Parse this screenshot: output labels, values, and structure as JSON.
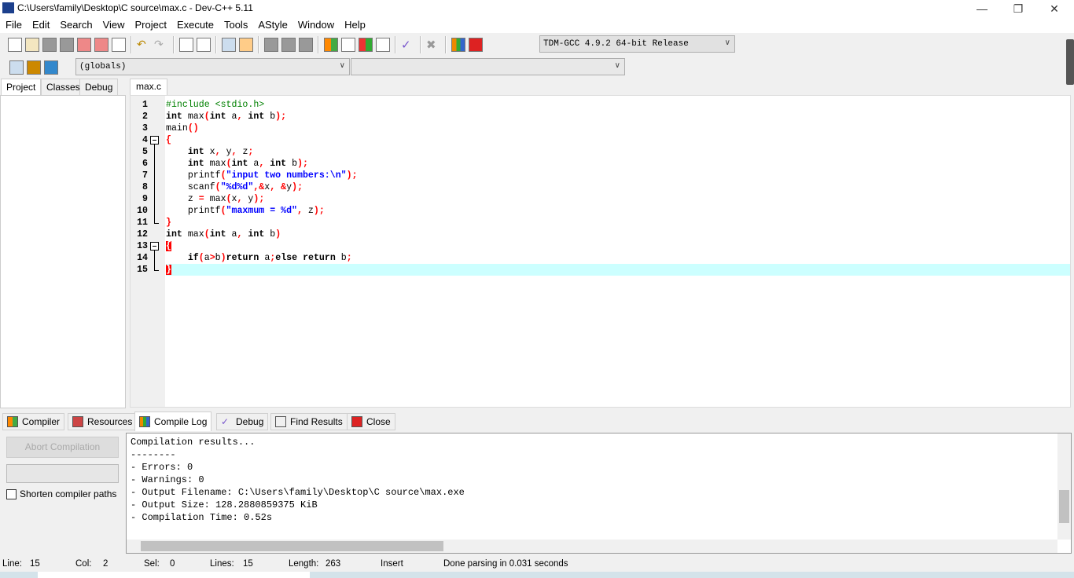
{
  "window": {
    "title": "C:\\Users\\family\\Desktop\\C source\\max.c - Dev-C++ 5.11",
    "icon_text": "DEV"
  },
  "menu": [
    "File",
    "Edit",
    "Search",
    "View",
    "Project",
    "Execute",
    "Tools",
    "AStyle",
    "Window",
    "Help"
  ],
  "toolbar": {
    "compiler_select": "TDM-GCC 4.9.2 64-bit Release",
    "scope_select": "(globals)",
    "member_select": ""
  },
  "left_tabs": [
    "Project",
    "Classes",
    "Debug"
  ],
  "editor": {
    "tab": "max.c",
    "current_line": 15,
    "lines": [
      [
        [
          "#include <stdio.h>",
          "c"
        ]
      ],
      [
        [
          "int",
          "k"
        ],
        [
          " max",
          "n"
        ],
        [
          "(",
          "p"
        ],
        [
          "int",
          "k"
        ],
        [
          " a",
          "n"
        ],
        [
          ",",
          "p"
        ],
        [
          " ",
          "n"
        ],
        [
          "int",
          "k"
        ],
        [
          " b",
          "n"
        ],
        [
          ");",
          "p"
        ]
      ],
      [
        [
          "main",
          "n"
        ],
        [
          "()",
          "p"
        ]
      ],
      [
        [
          "{",
          "p"
        ]
      ],
      [
        [
          "    ",
          "n"
        ],
        [
          "int",
          "k"
        ],
        [
          " x",
          "n"
        ],
        [
          ",",
          "p"
        ],
        [
          " y",
          "n"
        ],
        [
          ",",
          "p"
        ],
        [
          " z",
          "n"
        ],
        [
          ";",
          "p"
        ]
      ],
      [
        [
          "    ",
          "n"
        ],
        [
          "int",
          "k"
        ],
        [
          " max",
          "n"
        ],
        [
          "(",
          "p"
        ],
        [
          "int",
          "k"
        ],
        [
          " a",
          "n"
        ],
        [
          ",",
          "p"
        ],
        [
          " ",
          "n"
        ],
        [
          "int",
          "k"
        ],
        [
          " b",
          "n"
        ],
        [
          ");",
          "p"
        ]
      ],
      [
        [
          "    printf",
          "n"
        ],
        [
          "(",
          "p"
        ],
        [
          "\"input two numbers:\\n\"",
          "s"
        ],
        [
          ");",
          "p"
        ]
      ],
      [
        [
          "    scanf",
          "n"
        ],
        [
          "(",
          "p"
        ],
        [
          "\"%d%d\"",
          "s"
        ],
        [
          ",&",
          "p"
        ],
        [
          "x",
          "n"
        ],
        [
          ",",
          "p"
        ],
        [
          " ",
          "n"
        ],
        [
          "&",
          "p"
        ],
        [
          "y",
          "n"
        ],
        [
          ");",
          "p"
        ]
      ],
      [
        [
          "    z ",
          "n"
        ],
        [
          "=",
          "p"
        ],
        [
          " max",
          "n"
        ],
        [
          "(",
          "p"
        ],
        [
          "x",
          "n"
        ],
        [
          ",",
          "p"
        ],
        [
          " y",
          "n"
        ],
        [
          ");",
          "p"
        ]
      ],
      [
        [
          "    printf",
          "n"
        ],
        [
          "(",
          "p"
        ],
        [
          "\"maxmum = %d\"",
          "s"
        ],
        [
          ",",
          "p"
        ],
        [
          " z",
          "n"
        ],
        [
          ");",
          "p"
        ]
      ],
      [
        [
          "}",
          "p"
        ]
      ],
      [
        [
          "int",
          "k"
        ],
        [
          " max",
          "n"
        ],
        [
          "(",
          "p"
        ],
        [
          "int",
          "k"
        ],
        [
          " a",
          "n"
        ],
        [
          ",",
          "p"
        ],
        [
          " ",
          "n"
        ],
        [
          "int",
          "k"
        ],
        [
          " b",
          "n"
        ],
        [
          ")",
          "p"
        ]
      ],
      [
        [
          "{",
          "b"
        ]
      ],
      [
        [
          "    ",
          "n"
        ],
        [
          "if",
          "k"
        ],
        [
          "(",
          "p"
        ],
        [
          "a",
          "n"
        ],
        [
          ">",
          "p"
        ],
        [
          "b",
          "n"
        ],
        [
          ")",
          "p"
        ],
        [
          "return",
          "k"
        ],
        [
          " a",
          "n"
        ],
        [
          ";",
          "p"
        ],
        [
          "else",
          "k"
        ],
        [
          " ",
          "n"
        ],
        [
          "return",
          "k"
        ],
        [
          " b",
          "n"
        ],
        [
          ";",
          "p"
        ]
      ],
      [
        [
          "}",
          "b"
        ]
      ]
    ]
  },
  "bottom_tabs": [
    "Compiler",
    "Resources",
    "Compile Log",
    "Debug",
    "Find Results",
    "Close"
  ],
  "bottom": {
    "abort_label": "Abort Compilation",
    "shorten_label": "Shorten compiler paths",
    "shorten_checked": false,
    "log": [
      "Compilation results...",
      "--------",
      "- Errors: 0",
      "- Warnings: 0",
      "- Output Filename: C:\\Users\\family\\Desktop\\C source\\max.exe",
      "- Output Size: 128.2880859375 KiB",
      "- Compilation Time: 0.52s"
    ]
  },
  "status": {
    "line_label": "Line:",
    "line": "15",
    "col_label": "Col:",
    "col": "2",
    "sel_label": "Sel:",
    "sel": "0",
    "lines_label": "Lines:",
    "lines": "15",
    "length_label": "Length:",
    "length": "263",
    "mode": "Insert",
    "message": "Done parsing in 0.031 seconds"
  },
  "colors": {
    "keyword": "#000000",
    "symbol": "#ff0000",
    "string": "#0000ff",
    "preprocessor": "#008000",
    "current_line": "#ccffff",
    "brace_match": "#ff0000"
  }
}
